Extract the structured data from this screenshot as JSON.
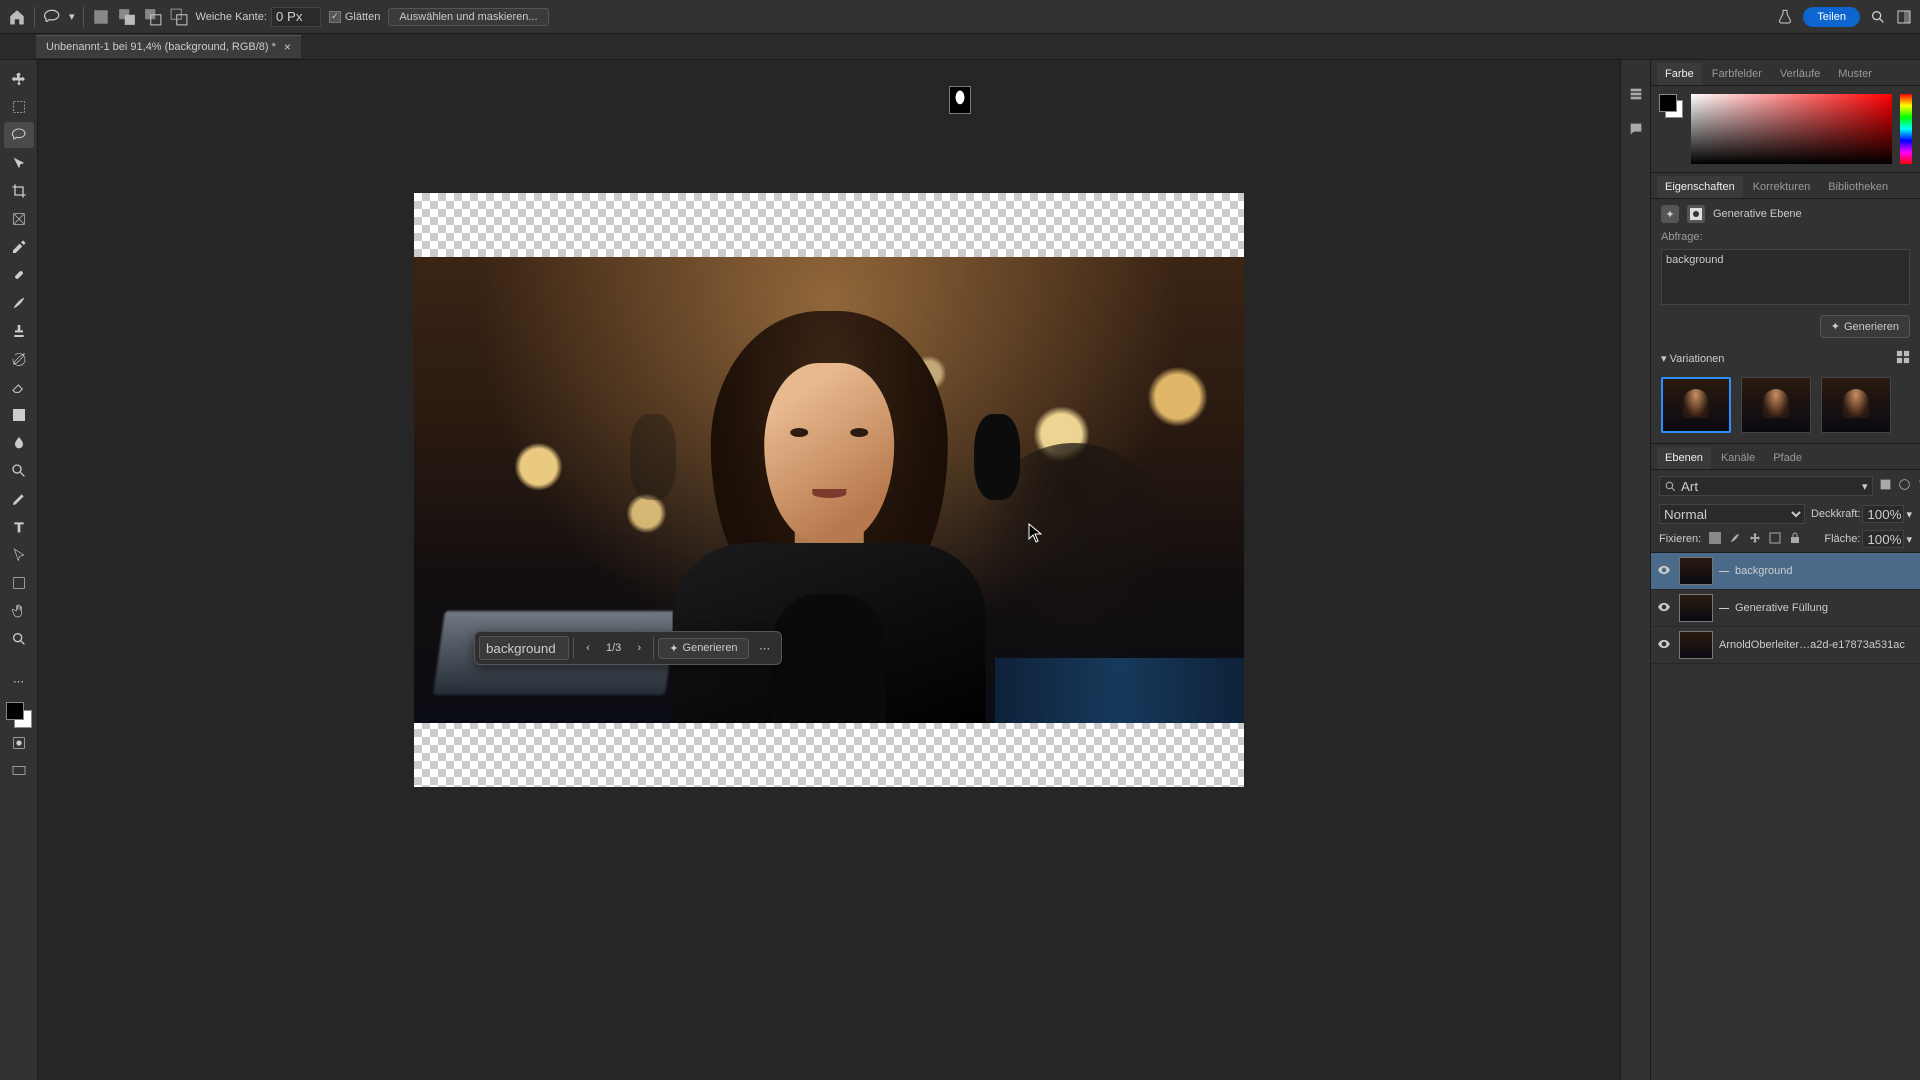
{
  "topbar": {
    "feather_label": "Weiche Kante:",
    "feather_value": "0 Px",
    "antialias_label": "Glätten",
    "select_mask_label": "Auswählen und maskieren...",
    "share_label": "Teilen"
  },
  "tab": {
    "title": "Unbenannt-1 bei 91,4% (background, RGB/8) *"
  },
  "floatbar": {
    "prompt": "background",
    "counter": "1/3",
    "generate_label": "Generieren"
  },
  "panels": {
    "color_tabs": {
      "farbe": "Farbe",
      "farbfelder": "Farbfelder",
      "verlaufe": "Verläufe",
      "muster": "Muster"
    },
    "prop_tabs": {
      "eigenschaften": "Eigenschaften",
      "korrekturen": "Korrekturen",
      "bibliotheken": "Bibliotheken"
    },
    "generative_layer_label": "Generative Ebene",
    "prompt_label": "Abfrage:",
    "prompt_value": "background",
    "generate_label": "Generieren",
    "variations_label": "Variationen",
    "layer_tabs": {
      "ebenen": "Ebenen",
      "kanale": "Kanäle",
      "pfade": "Pfade"
    },
    "search_kind": "Art",
    "blend_mode": "Normal",
    "opacity_label": "Deckkraft:",
    "opacity_value": "100%",
    "fill_label": "Fläche:",
    "fill_value": "100%",
    "lock_label": "Fixieren:"
  },
  "layers": [
    {
      "name": "background"
    },
    {
      "name": "Generative Füllung"
    },
    {
      "name": "ArnoldOberleiter…a2d-e17873a531ac"
    }
  ]
}
